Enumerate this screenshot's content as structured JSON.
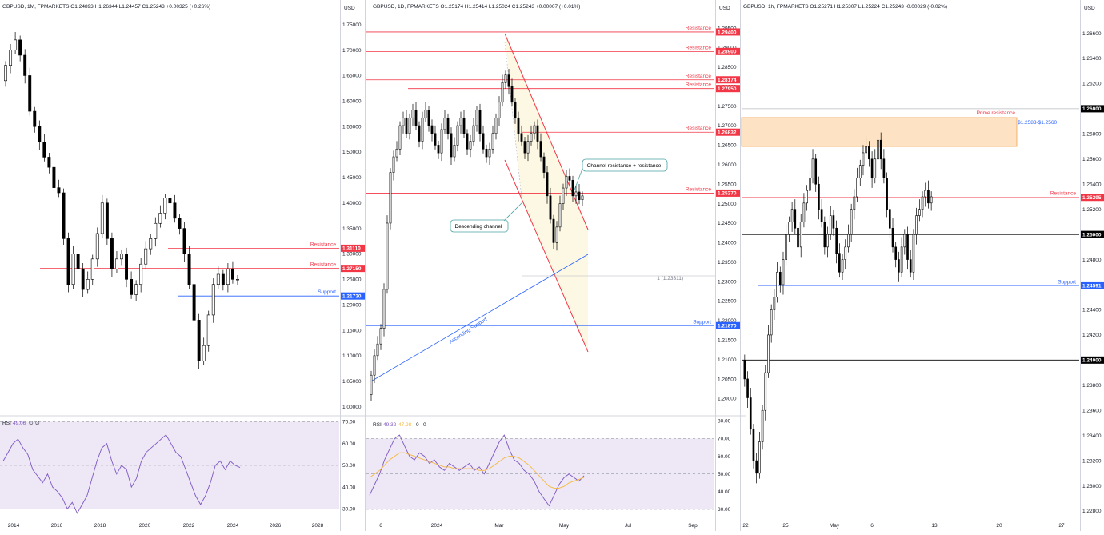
{
  "colors": {
    "candle": "#000000",
    "resistance": "#f23645",
    "support": "#2962ff",
    "rsi_line": "#7e57c2",
    "rsi_ma": "#f7b93a",
    "rsi_band": "#ede7f6",
    "zone_fill": "#fde2c3",
    "zone_border": "#f0a04a",
    "channel_fill": "#fdf8e4",
    "grid": "#e0e3eb",
    "callout_border": "#4ba3a3"
  },
  "panels": [
    {
      "id": "monthly",
      "header": "GBPUSD, 1M, FPMARKETS  O1.24893  H1.26344  L1.24457  C1.25243  +0.00325 (+0.26%)",
      "currency": "USD",
      "price_ticks": [
        "1.75000",
        "1.70000",
        "1.65000",
        "1.60000",
        "1.55000",
        "1.50000",
        "1.45000",
        "1.40000",
        "1.35000",
        "1.30000",
        "1.25000",
        "1.20000",
        "1.15000",
        "1.10000",
        "1.05000",
        "1.00000"
      ],
      "x_ticks": [
        "2014",
        "2016",
        "2018",
        "2020",
        "2022",
        "2024",
        "2026",
        "2028"
      ],
      "rsi_header": {
        "label": "RSI",
        "value": "49.06",
        "extra": [
          "∅",
          "∅"
        ]
      },
      "rsi_ticks": [
        "70.00",
        "60.00",
        "50.00",
        "40.00",
        "30.00"
      ],
      "levels": [
        {
          "price": "1.31110",
          "label": "Resistance",
          "kind": "resistance"
        },
        {
          "price": "1.27150",
          "label": "Resistance",
          "kind": "resistance"
        },
        {
          "price": "1.21730",
          "label": "Support",
          "kind": "support"
        }
      ],
      "chart_data": {
        "type": "candlestick",
        "ylim": [
          0.99,
          1.77
        ],
        "closes": [
          1.67,
          1.7,
          1.72,
          1.69,
          1.65,
          1.58,
          1.55,
          1.52,
          1.49,
          1.47,
          1.43,
          1.42,
          1.33,
          1.24,
          1.3,
          1.27,
          1.23,
          1.25,
          1.29,
          1.34,
          1.4,
          1.33,
          1.27,
          1.29,
          1.3,
          1.25,
          1.22,
          1.24,
          1.28,
          1.31,
          1.33,
          1.36,
          1.38,
          1.41,
          1.4,
          1.37,
          1.35,
          1.3,
          1.24,
          1.17,
          1.09,
          1.12,
          1.18,
          1.24,
          1.26,
          1.24,
          1.27,
          1.25,
          1.25
        ],
        "rsi": [
          52,
          56,
          60,
          62,
          58,
          55,
          48,
          45,
          42,
          46,
          40,
          38,
          35,
          30,
          33,
          28,
          32,
          36,
          44,
          52,
          58,
          60,
          52,
          46,
          50,
          48,
          40,
          44,
          52,
          56,
          58,
          60,
          62,
          64,
          60,
          56,
          54,
          48,
          42,
          36,
          32,
          36,
          42,
          50,
          52,
          48,
          52,
          50,
          49
        ],
        "rsi_ylim": [
          25,
          72
        ]
      }
    },
    {
      "id": "daily",
      "header": "GBPUSD, 1D, FPMARKETS  O1.25174  H1.25414  L1.25024  C1.25243  +0.00007 (+0.01%)",
      "currency": "USD",
      "price_ticks": [
        "1.29500",
        "1.29000",
        "1.28500",
        "1.28000",
        "1.27500",
        "1.27000",
        "1.26500",
        "1.26000",
        "1.25500",
        "1.25000",
        "1.24500",
        "1.24000",
        "1.23500",
        "1.23000",
        "1.22500",
        "1.22000",
        "1.21500",
        "1.21000",
        "1.20500",
        "1.20000"
      ],
      "x_ticks": [
        "6",
        "2024",
        "Mar",
        "May",
        "Jul",
        "Sep"
      ],
      "rsi_header": {
        "label": "RSI",
        "value": "49.32",
        "ma": "47.98",
        "extra": [
          "0",
          "0"
        ]
      },
      "rsi_ticks": [
        "80.00",
        "70.00",
        "60.00",
        "50.00",
        "40.00",
        "30.00"
      ],
      "levels": [
        {
          "price": "1.29400",
          "label": "Resistance",
          "kind": "resistance"
        },
        {
          "price": "1.28900",
          "label": "Resistance",
          "kind": "resistance"
        },
        {
          "price": "1.28174",
          "label": "Resistance",
          "kind": "resistance"
        },
        {
          "price": "1.27950",
          "label": "Resistance",
          "kind": "resistance"
        },
        {
          "price": "1.26832",
          "label": "Resistance",
          "kind": "resistance"
        },
        {
          "price": "1.25270",
          "label": "Resistance",
          "kind": "resistance"
        },
        {
          "price": "1.21870",
          "label": "Support",
          "kind": "support"
        }
      ],
      "annotations": {
        "channel_resistance": "Channel resistance + resistance",
        "descending_channel": "Descending channel",
        "ascending_support": "Ascending Support",
        "fib_label": "1 (1.23311)"
      },
      "chart_data": {
        "type": "candlestick",
        "ylim": [
          1.196,
          1.2985
        ],
        "closes": [
          1.206,
          1.211,
          1.214,
          1.218,
          1.228,
          1.245,
          1.258,
          1.262,
          1.264,
          1.27,
          1.272,
          1.268,
          1.272,
          1.274,
          1.27,
          1.266,
          1.272,
          1.274,
          1.27,
          1.268,
          1.265,
          1.263,
          1.269,
          1.272,
          1.268,
          1.262,
          1.265,
          1.27,
          1.272,
          1.268,
          1.264,
          1.266,
          1.27,
          1.274,
          1.268,
          1.264,
          1.262,
          1.264,
          1.268,
          1.272,
          1.276,
          1.281,
          1.283,
          1.28,
          1.276,
          1.272,
          1.268,
          1.266,
          1.263,
          1.266,
          1.268,
          1.27,
          1.266,
          1.262,
          1.258,
          1.252,
          1.246,
          1.24,
          1.244,
          1.25,
          1.254,
          1.257,
          1.256,
          1.252,
          1.253,
          1.251,
          1.252
        ],
        "rsi": [
          38,
          44,
          50,
          58,
          64,
          70,
          72,
          66,
          60,
          58,
          62,
          60,
          56,
          58,
          54,
          52,
          56,
          54,
          52,
          54,
          56,
          52,
          54,
          50,
          56,
          62,
          68,
          72,
          64,
          58,
          56,
          52,
          50,
          46,
          40,
          36,
          32,
          38,
          44,
          48,
          50,
          48,
          46,
          49
        ],
        "rsi_ma": [
          48,
          50,
          52,
          55,
          58,
          60,
          62,
          62,
          61,
          60,
          59,
          58,
          57,
          56,
          55,
          54,
          54,
          53,
          53,
          53,
          53,
          53,
          52,
          52,
          53,
          55,
          57,
          59,
          60,
          60,
          59,
          57,
          55,
          52,
          49,
          46,
          43,
          42,
          42,
          43,
          45,
          46,
          47,
          48
        ],
        "rsi_ylim": [
          25,
          82
        ]
      }
    },
    {
      "id": "hourly",
      "header": "GBPUSD, 1h, FPMARKETS  O1.25271  H1.25307  L1.25224  C1.25243  -0.00029 (-0.02%)",
      "currency": "USD",
      "price_ticks": [
        "1.26600",
        "1.26400",
        "1.26200",
        "1.26000",
        "1.25800",
        "1.25600",
        "1.25400",
        "1.25200",
        "1.25000",
        "1.24800",
        "1.24600",
        "1.24400",
        "1.24200",
        "1.24000",
        "1.23800",
        "1.23600",
        "1.23400",
        "1.23200",
        "1.23000",
        "1.22800"
      ],
      "x_ticks": [
        "22",
        "25",
        "May",
        "6",
        "13",
        "20",
        "27"
      ],
      "levels": [
        {
          "price": "1.26000",
          "label": "",
          "kind": "round"
        },
        {
          "price": "1.25295",
          "label": "Resistance",
          "kind": "resistance"
        },
        {
          "price": "1.25000",
          "label": "",
          "kind": "round"
        },
        {
          "price": "1.24591",
          "label": "Support",
          "kind": "support"
        },
        {
          "price": "1.24000",
          "label": "",
          "kind": "round"
        }
      ],
      "zone": {
        "label": "Prime resistance",
        "range_label": "$1.2583-$1.2560"
      },
      "chart_data": {
        "type": "candlestick",
        "ylim": [
          1.2273,
          1.2675
        ],
        "closes": [
          1.2385,
          1.237,
          1.2345,
          1.232,
          1.231,
          1.2335,
          1.236,
          1.239,
          1.242,
          1.244,
          1.245,
          1.247,
          1.246,
          1.248,
          1.25,
          1.251,
          1.252,
          1.2505,
          1.249,
          1.251,
          1.2525,
          1.2535,
          1.2545,
          1.256,
          1.254,
          1.252,
          1.251,
          1.249,
          1.25,
          1.2515,
          1.2505,
          1.2485,
          1.247,
          1.248,
          1.249,
          1.25,
          1.252,
          1.253,
          1.2545,
          1.2555,
          1.2565,
          1.257,
          1.256,
          1.2545,
          1.256,
          1.2575,
          1.256,
          1.2545,
          1.252,
          1.2505,
          1.249,
          1.248,
          1.247,
          1.249,
          1.25,
          1.248,
          1.247,
          1.25,
          1.2515,
          1.252,
          1.253,
          1.2535,
          1.2525,
          1.253
        ]
      }
    }
  ]
}
